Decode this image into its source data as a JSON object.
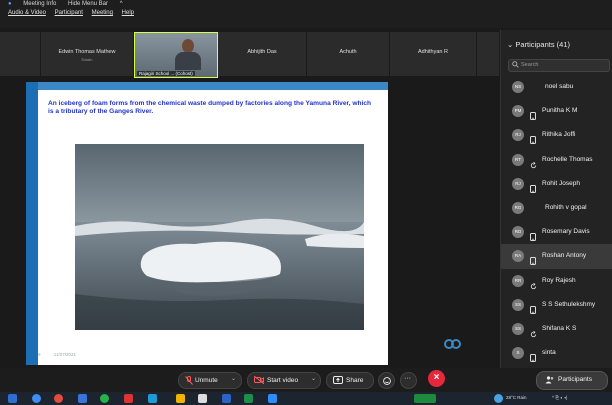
{
  "topbar": {
    "meeting_info": "Meeting Info",
    "hide_menu_bar": "Hide Menu Bar",
    "menus": [
      "Audio & Video",
      "Participant",
      "Meeting",
      "Help"
    ]
  },
  "gallery": {
    "tiles": [
      {
        "name": "Edwin Thomas Mathew",
        "sub": "Edwin"
      },
      {
        "name": "Rajagiri School ... (Cohost)"
      },
      {
        "name": "Abhijith Das"
      },
      {
        "name": "Achuth"
      },
      {
        "name": "Adhithyan R"
      }
    ]
  },
  "slide": {
    "heading": "An iceberg of foam forms from the chemical waste dumped by factories along the Yamuna River, which is a tributary of the Ganges River.",
    "footer_num": "9",
    "footer_date": "11/07/2021"
  },
  "participants": {
    "title": "Participants (41)",
    "search_placeholder": "Search",
    "list": [
      {
        "initials": "NS",
        "name": "noel sabu",
        "icon": "none",
        "color": "#7a7a7a"
      },
      {
        "initials": "PM",
        "name": "Punitha K M",
        "icon": "phone",
        "color": "#7a7a7a"
      },
      {
        "initials": "RJ",
        "name": "Rithika Joffi",
        "icon": "phone",
        "color": "#7a7a7a"
      },
      {
        "initials": "RT",
        "name": "Rochelle Thomas",
        "icon": "refresh",
        "color": "#7a7a7a"
      },
      {
        "initials": "RJ",
        "name": "Rohit Joseph",
        "icon": "phone",
        "color": "#7a7a7a"
      },
      {
        "initials": "RG",
        "name": "Rohith v gopal",
        "icon": "none",
        "color": "#7a7a7a"
      },
      {
        "initials": "RD",
        "name": "Rosemary Davis",
        "icon": "phone",
        "color": "#7a7a7a"
      },
      {
        "initials": "RA",
        "name": "Roshan Antony",
        "icon": "phone",
        "color": "#7a7a7a",
        "highlight": true
      },
      {
        "initials": "RR",
        "name": "Roy Rajesh",
        "icon": "refresh",
        "color": "#7a7a7a"
      },
      {
        "initials": "SS",
        "name": "S S Sethulekshmy",
        "icon": "phone",
        "color": "#7a7a7a"
      },
      {
        "initials": "SS",
        "name": "Shifana K S",
        "icon": "refresh",
        "color": "#7a7a7a"
      },
      {
        "initials": "S",
        "name": "sinta",
        "icon": "phone",
        "color": "#7a7a7a"
      }
    ]
  },
  "controls": {
    "unmute": "Unmute",
    "start_video": "Start video",
    "share": "Share",
    "participants": "Participants"
  },
  "taskbar": {
    "weather": "28°C Rain"
  },
  "colors": {
    "accent": "#1d6fb3",
    "leave": "#e5283b",
    "heading_text": "#2233cc"
  }
}
